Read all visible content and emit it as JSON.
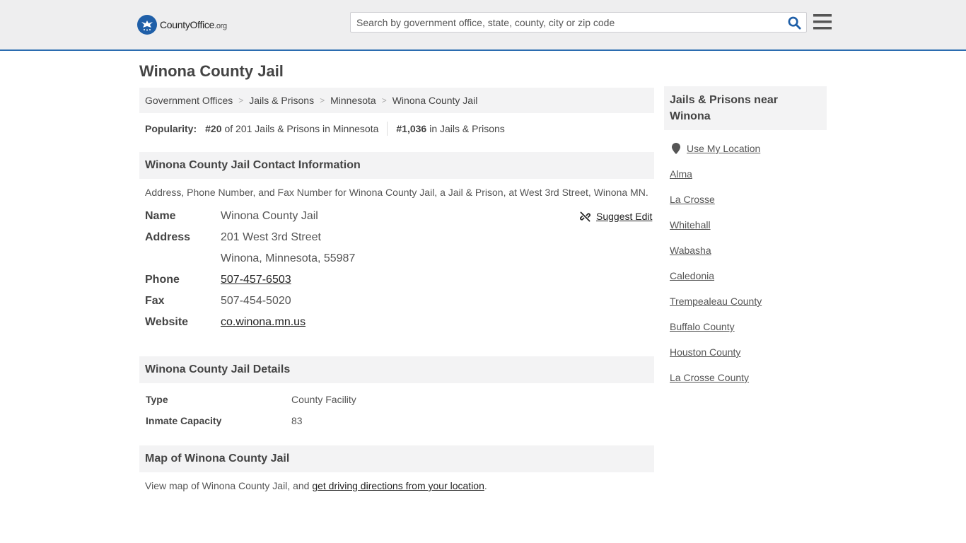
{
  "header": {
    "logo_brand": "CountyOffice",
    "logo_tld": ".org",
    "search_placeholder": "Search by government office, state, county, city or zip code",
    "icons": {
      "search": "search-icon",
      "menu": "hamburger-menu-icon",
      "logo": "eagle-seal-icon"
    },
    "accent_color": "#2b6cb0"
  },
  "page": {
    "title": "Winona County Jail"
  },
  "breadcrumb": [
    "Government Offices",
    "Jails & Prisons",
    "Minnesota",
    "Winona County Jail"
  ],
  "popularity": {
    "label": "Popularity:",
    "state_rank": "#20",
    "state_text": "of 201 Jails & Prisons in Minnesota",
    "national_rank": "#1,036",
    "national_text": "in Jails & Prisons"
  },
  "contact": {
    "heading": "Winona County Jail Contact Information",
    "description": "Address, Phone Number, and Fax Number for Winona County Jail, a Jail & Prison, at West 3rd Street, Winona MN.",
    "suggest_edit": "Suggest Edit",
    "rows": [
      {
        "label": "Name",
        "value": "Winona County Jail"
      },
      {
        "label": "Address",
        "value": "201 West 3rd Street"
      },
      {
        "label": "",
        "value": "Winona, Minnesota, 55987"
      },
      {
        "label": "Phone",
        "value": "507-457-6503"
      },
      {
        "label": "Fax",
        "value": "507-454-5020"
      },
      {
        "label": "Website",
        "value": "co.winona.mn.us"
      }
    ]
  },
  "details": {
    "heading": "Winona County Jail Details",
    "rows": [
      {
        "label": "Type",
        "value": "County Facility"
      },
      {
        "label": "Inmate Capacity",
        "value": "83"
      }
    ]
  },
  "map": {
    "heading": "Map of Winona County Jail",
    "text_before": "View map of Winona County Jail, and ",
    "link": "get driving directions from your location",
    "text_after": "."
  },
  "sidebar": {
    "heading": "Jails & Prisons near Winona",
    "use_location": "Use My Location",
    "items": [
      "Alma",
      "La Crosse",
      "Whitehall",
      "Wabasha",
      "Caledonia",
      "Trempealeau County",
      "Buffalo County",
      "Houston County",
      "La Crosse County"
    ]
  }
}
